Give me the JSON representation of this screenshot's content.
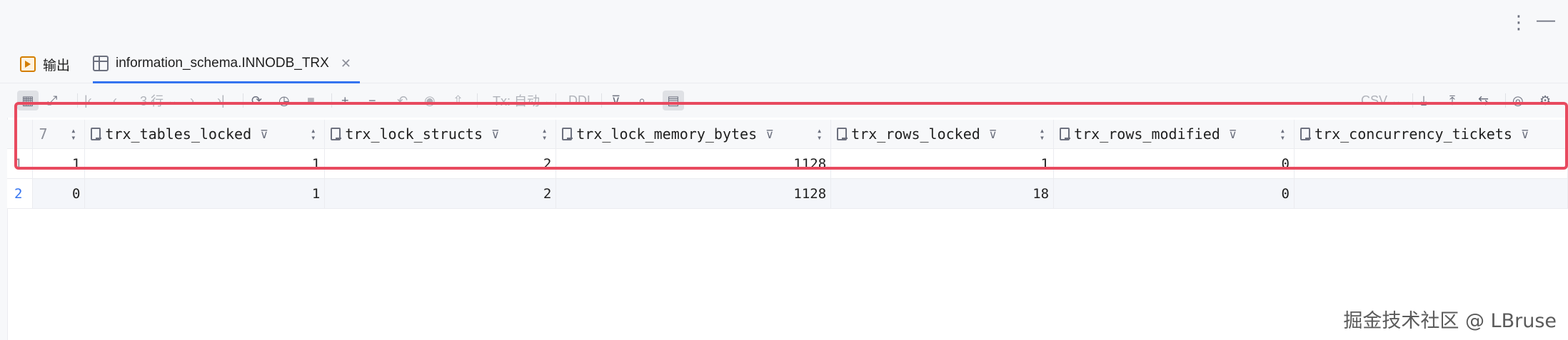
{
  "tabs": [
    {
      "label": "输出",
      "icon": "output-icon"
    },
    {
      "label": "information_schema.INNODB_TRX",
      "icon": "table-grid-icon",
      "active": true
    }
  ],
  "toolbar": {
    "rows_label": "3 行",
    "tx_mode": "Tx: 自动",
    "ddl_label": "DDL",
    "export_format": "CSV"
  },
  "grid": {
    "first_column_fragment": "7",
    "columns": [
      "trx_tables_locked",
      "trx_lock_structs",
      "trx_lock_memory_bytes",
      "trx_rows_locked",
      "trx_rows_modified",
      "trx_concurrency_tickets"
    ],
    "rows": [
      {
        "num": "1",
        "lead": "1",
        "cells": [
          "1",
          "2",
          "1128",
          "1",
          "0",
          ""
        ]
      },
      {
        "num": "2",
        "lead": "0",
        "cells": [
          "1",
          "2",
          "1128",
          "18",
          "0",
          ""
        ]
      }
    ]
  },
  "watermark": "掘金技术社区 @ LBruse",
  "colors": {
    "accent": "#3574f0",
    "highlight": "#e84a5f"
  }
}
